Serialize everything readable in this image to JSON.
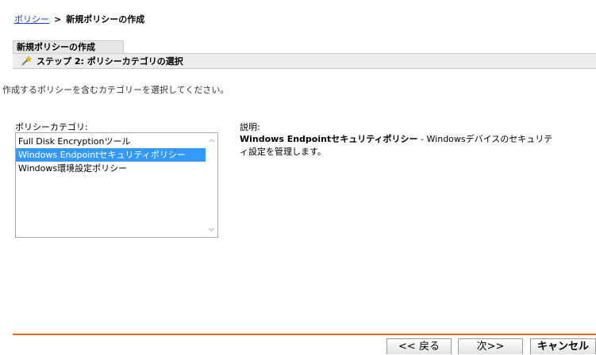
{
  "breadcrumb": {
    "link": "ポリシー",
    "separator": ">",
    "current": "新規ポリシーの作成"
  },
  "wizard": {
    "tab_title": "新規ポリシーの作成",
    "step_title": "ステップ 2: ポリシーカテゴリの選択",
    "step_icon": "wand-icon"
  },
  "instruction": "作成するポリシーを含むカテゴリーを選択してください。",
  "category": {
    "label": "ポリシーカテゴリ:",
    "items": [
      "Full Disk Encryptionツール",
      "Windows Endpointセキュリティポリシー",
      "Windows環境設定ポリシー"
    ],
    "selected_index": 1
  },
  "description": {
    "label": "説明:",
    "title": "Windows Endpointセキュリティポリシー",
    "text": " - Windowsデバイスのセキュリティ設定を管理します。"
  },
  "buttons": {
    "back": "<< 戻る",
    "next": "次>>",
    "cancel": "キャンセル"
  },
  "colors": {
    "link": "#1a3cc0",
    "selection": "#3399ff",
    "divider": "#e06a1a"
  }
}
